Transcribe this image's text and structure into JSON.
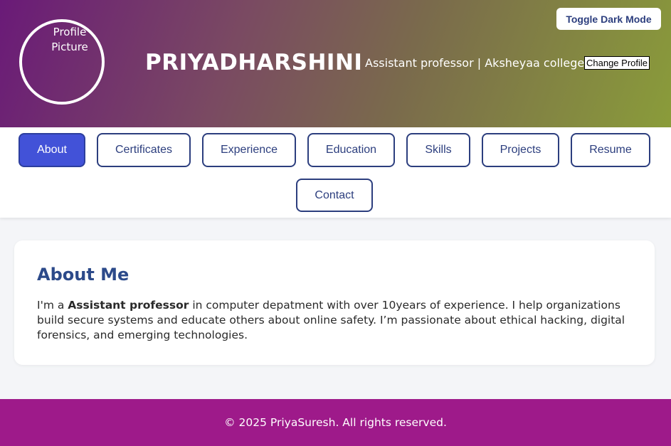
{
  "header": {
    "avatar_text": "Profile Picture",
    "name": "PRIYADHARSHINI",
    "role": "Assistant professor | Aksheyaa college",
    "change_profile_label": "Change Profile",
    "toggle_dark_label": "Toggle Dark Mode"
  },
  "nav": {
    "tabs": [
      "About",
      "Certificates",
      "Experience",
      "Education",
      "Skills",
      "Projects",
      "Resume",
      "Contact"
    ],
    "active": "About"
  },
  "about": {
    "title": "About Me",
    "text_prefix": "I'm a ",
    "text_bold": "Assistant professor",
    "text_rest": " in computer depatment with over 10years of experience. I help organizations build secure systems and educate others about online safety. I’m passionate about ethical hacking, digital forensics, and emerging technologies."
  },
  "footer": {
    "text": "© 2025 PriyaSuresh. All rights reserved."
  },
  "colors": {
    "primary": "#2c3e7e",
    "active_tab": "#4252d8",
    "footer": "#9e1a8a"
  }
}
